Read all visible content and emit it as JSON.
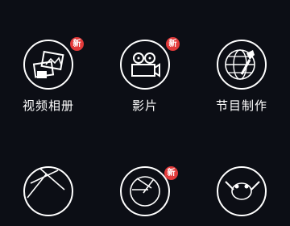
{
  "grid": {
    "items": [
      {
        "label": "视频相册",
        "icon": "photo-album-icon",
        "badge": "新"
      },
      {
        "label": "影片",
        "icon": "movie-camera-icon",
        "badge": "新"
      },
      {
        "label": "节目制作",
        "icon": "globe-microphone-icon",
        "badge": ""
      },
      {
        "label": "",
        "icon": "aperture-lines-icon",
        "badge": ""
      },
      {
        "label": "",
        "icon": "shutter-icon",
        "badge": "新"
      },
      {
        "label": "",
        "icon": "tools-icon",
        "badge": ""
      }
    ]
  },
  "colors": {
    "background": "#0c0e15",
    "badge": "#e23a3a",
    "stroke": "#ffffff"
  }
}
